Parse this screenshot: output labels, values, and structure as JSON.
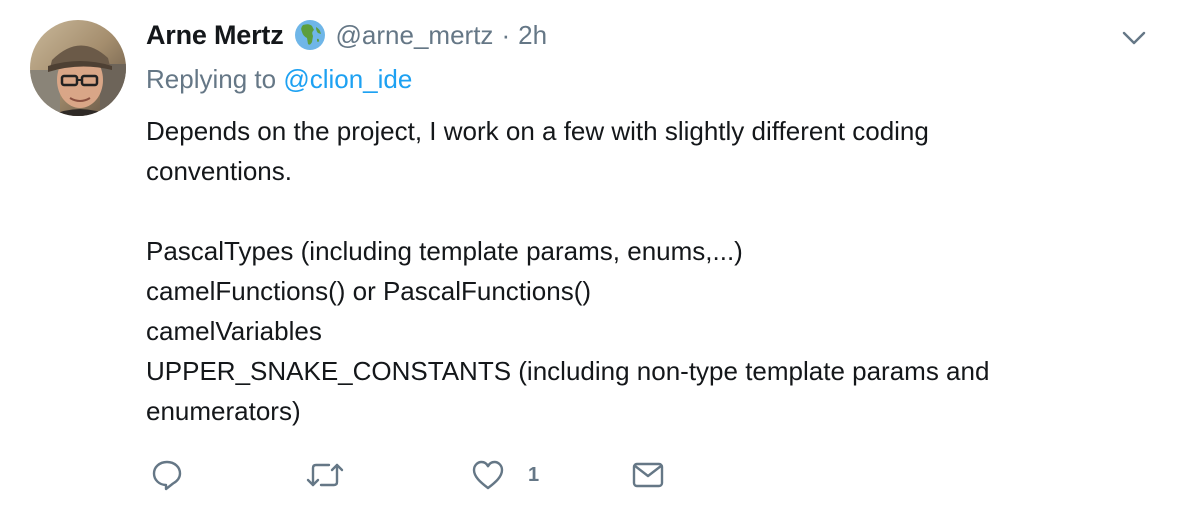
{
  "author": {
    "display_name": "Arne Mertz",
    "badge_icon": "globe-africa-icon",
    "handle": "@arne_mertz",
    "separator": "·",
    "time": "2h"
  },
  "reply": {
    "prefix": "Replying to ",
    "mention": "@clion_ide"
  },
  "body": {
    "line1": "Depends on the project, I work on a few with slightly different coding",
    "line2": "conventions.",
    "line3": "PascalTypes (including template params, enums,...)",
    "line4": "camelFunctions() or PascalFunctions()",
    "line5": "camelVariables",
    "line6": "UPPER_SNAKE_CONSTANTS (including non-type template params and",
    "line7": "enumerators)"
  },
  "actions": {
    "reply_icon": "reply-icon",
    "retweet_icon": "retweet-icon",
    "like_icon": "heart-icon",
    "like_count": "1",
    "dm_icon": "envelope-icon",
    "menu_icon": "chevron-down-icon"
  },
  "colors": {
    "text": "#14171a",
    "secondary": "#657786",
    "link": "#1da1f2"
  }
}
